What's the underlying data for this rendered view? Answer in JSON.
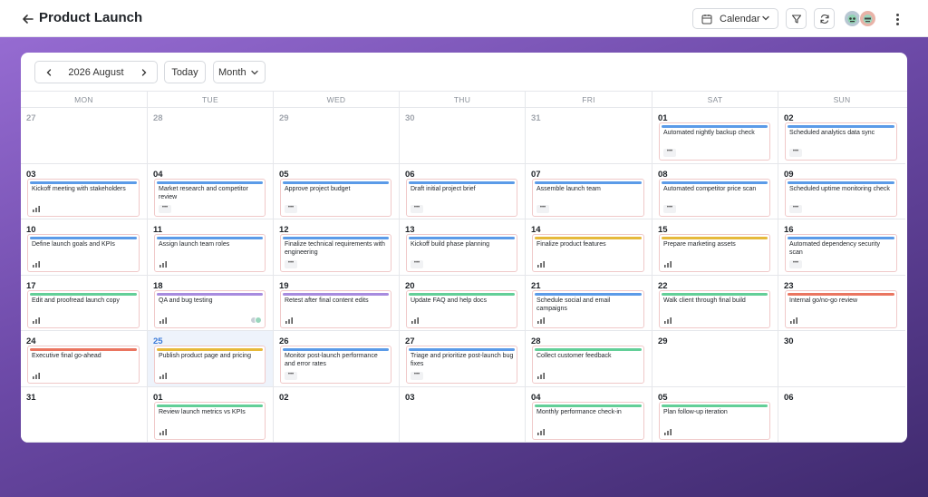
{
  "header": {
    "title": "Product Launch",
    "view_label": "Calendar"
  },
  "toolbar": {
    "month_label": "2026 August",
    "today_label": "Today",
    "scale_label": "Month"
  },
  "colors": {
    "blue": "#5b9be8",
    "purple": "#a78bdf",
    "green": "#63cf98",
    "yellow": "#e6b93a",
    "red": "#ea7560",
    "today_bg": "#eef3fb"
  },
  "weekdays": [
    "MON",
    "TUE",
    "WED",
    "THU",
    "FRI",
    "SAT",
    "SUN"
  ],
  "weeks": [
    [
      {
        "day": "27",
        "other": true
      },
      {
        "day": "28",
        "other": true
      },
      {
        "day": "29",
        "other": true
      },
      {
        "day": "30",
        "other": true
      },
      {
        "day": "31",
        "other": true
      },
      {
        "day": "01",
        "event": {
          "title": "Automated nightly backup check",
          "color": "blue",
          "footer": "dash"
        }
      },
      {
        "day": "02",
        "event": {
          "title": "Scheduled analytics data sync",
          "color": "blue",
          "footer": "dash"
        }
      }
    ],
    [
      {
        "day": "03",
        "event": {
          "title": "Kickoff meeting with stakeholders",
          "color": "blue",
          "footer": "chart"
        }
      },
      {
        "day": "04",
        "event": {
          "title": "Market research and competitor review",
          "color": "blue",
          "footer": "dash"
        }
      },
      {
        "day": "05",
        "event": {
          "title": "Approve project budget",
          "color": "blue",
          "footer": "dash"
        }
      },
      {
        "day": "06",
        "event": {
          "title": "Draft initial project brief",
          "color": "blue",
          "footer": "dash"
        }
      },
      {
        "day": "07",
        "event": {
          "title": "Assemble launch team",
          "color": "blue",
          "footer": "dash"
        }
      },
      {
        "day": "08",
        "event": {
          "title": "Automated competitor price scan",
          "color": "blue",
          "footer": "dash"
        }
      },
      {
        "day": "09",
        "event": {
          "title": "Scheduled uptime monitoring check",
          "color": "blue",
          "footer": "dash"
        }
      }
    ],
    [
      {
        "day": "10",
        "event": {
          "title": "Define launch goals and KPIs",
          "color": "blue",
          "footer": "chart"
        }
      },
      {
        "day": "11",
        "event": {
          "title": "Assign launch team roles",
          "color": "blue",
          "footer": "chart"
        }
      },
      {
        "day": "12",
        "event": {
          "title": "Finalize technical requirements with engineering",
          "color": "blue",
          "footer": "dash"
        }
      },
      {
        "day": "13",
        "event": {
          "title": "Kickoff build phase planning",
          "color": "blue",
          "footer": "dash"
        }
      },
      {
        "day": "14",
        "event": {
          "title": "Finalize product features",
          "color": "yellow",
          "footer": "chart"
        }
      },
      {
        "day": "15",
        "event": {
          "title": "Prepare marketing assets",
          "color": "yellow",
          "footer": "chart"
        }
      },
      {
        "day": "16",
        "event": {
          "title": "Automated dependency security scan",
          "color": "blue",
          "footer": "dash"
        }
      }
    ],
    [
      {
        "day": "17",
        "event": {
          "title": "Edit and proofread launch copy",
          "color": "green",
          "footer": "chart"
        }
      },
      {
        "day": "18",
        "event": {
          "title": "QA and bug testing",
          "color": "purple",
          "footer": "chart",
          "avatars": true
        }
      },
      {
        "day": "19",
        "event": {
          "title": "Retest after final content edits",
          "color": "purple",
          "footer": "chart"
        }
      },
      {
        "day": "20",
        "event": {
          "title": "Update FAQ and help docs",
          "color": "green",
          "footer": "chart"
        }
      },
      {
        "day": "21",
        "event": {
          "title": "Schedule social and email campaigns",
          "color": "blue",
          "footer": "chart"
        }
      },
      {
        "day": "22",
        "event": {
          "title": "Walk client through final build",
          "color": "green",
          "footer": "chart"
        }
      },
      {
        "day": "23",
        "event": {
          "title": "Internal go/no-go review",
          "color": "red",
          "footer": "chart"
        }
      }
    ],
    [
      {
        "day": "24",
        "event": {
          "title": "Executive final go-ahead",
          "color": "red",
          "footer": "chart"
        }
      },
      {
        "day": "25",
        "today": true,
        "event": {
          "title": "Publish product page and pricing",
          "color": "yellow",
          "footer": "chart"
        }
      },
      {
        "day": "26",
        "event": {
          "title": "Monitor post-launch performance and error rates",
          "color": "blue",
          "footer": "dash"
        }
      },
      {
        "day": "27",
        "event": {
          "title": "Triage and prioritize post-launch bug fixes",
          "color": "blue",
          "footer": "dash"
        }
      },
      {
        "day": "28",
        "event": {
          "title": "Collect customer feedback",
          "color": "green",
          "footer": "chart"
        }
      },
      {
        "day": "29"
      },
      {
        "day": "30"
      }
    ],
    [
      {
        "day": "31"
      },
      {
        "day": "01",
        "event": {
          "title": "Review launch metrics vs KPIs",
          "color": "green",
          "footer": "chart"
        }
      },
      {
        "day": "02"
      },
      {
        "day": "03"
      },
      {
        "day": "04",
        "event": {
          "title": "Monthly performance check-in",
          "color": "green",
          "footer": "chart"
        }
      },
      {
        "day": "05",
        "event": {
          "title": "Plan follow-up iteration",
          "color": "green",
          "footer": "chart"
        }
      },
      {
        "day": "06"
      }
    ]
  ]
}
